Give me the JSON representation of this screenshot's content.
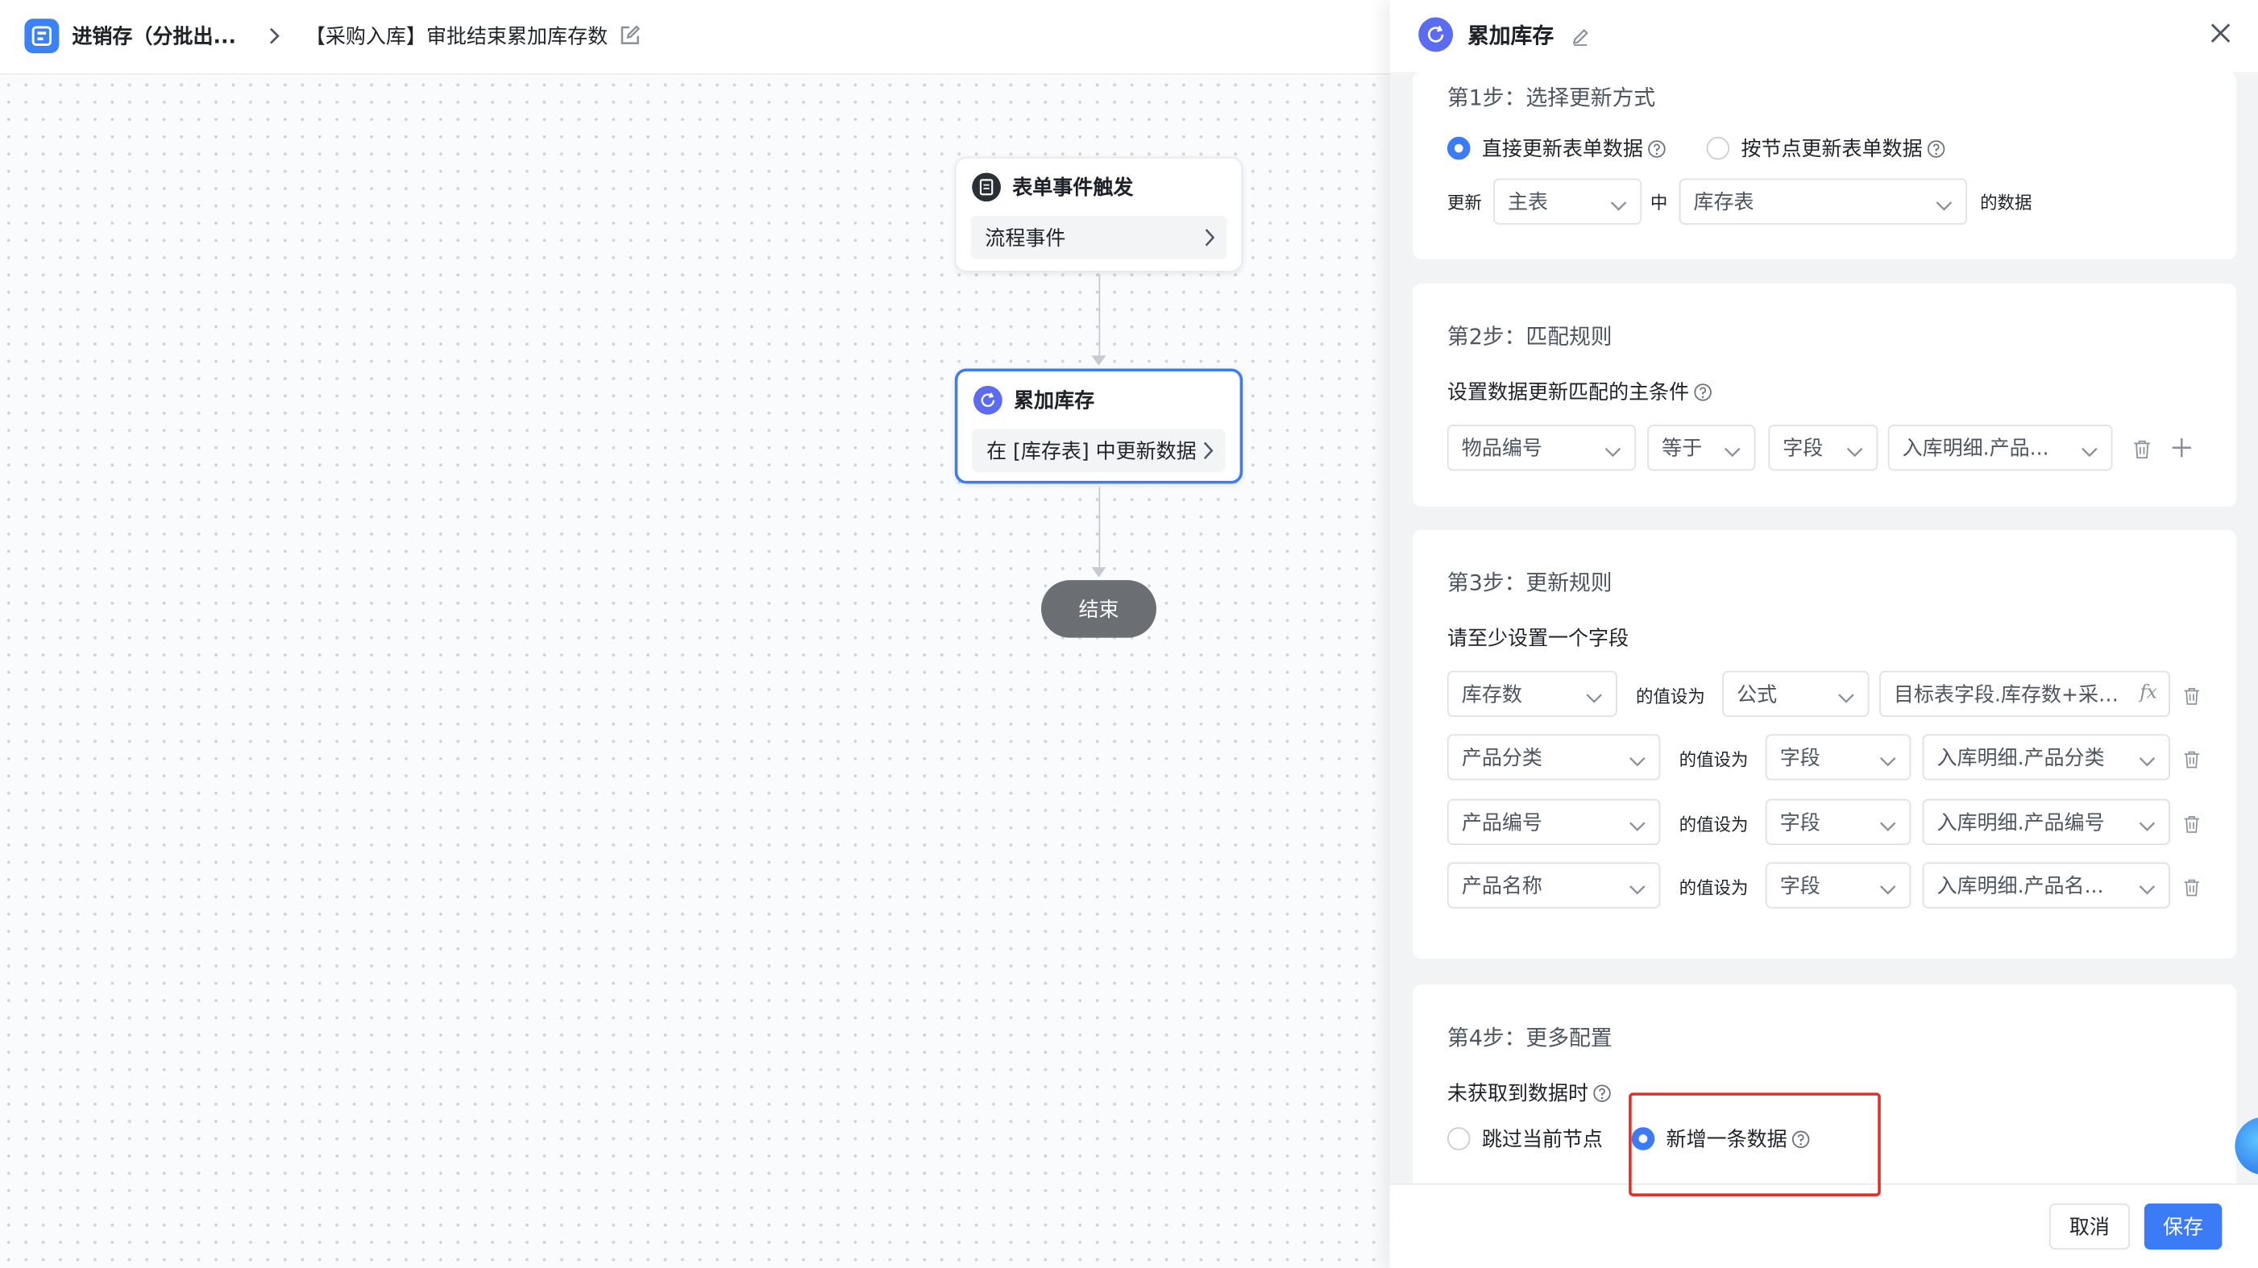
{
  "topbar": {
    "app_name": "进销存（分批出...",
    "flow_name": "【采购入库】审批结束累加库存数"
  },
  "canvas": {
    "trigger_node": {
      "title": "表单事件触发",
      "body": "流程事件"
    },
    "update_node": {
      "title": "累加库存",
      "body": "在 [库存表] 中更新数据"
    },
    "end_node": {
      "label": "结束"
    }
  },
  "panel": {
    "title": "累加库存",
    "step1": {
      "title": "第1步：选择更新方式",
      "option_direct": "直接更新表单数据",
      "option_by_node": "按节点更新表单数据",
      "selected": "direct",
      "update_label": "更新",
      "table_select": "主表",
      "in_label": "中",
      "target_select": "库存表",
      "data_suffix": "的数据"
    },
    "step2": {
      "title": "第2步：匹配规则",
      "desc": "设置数据更新匹配的主条件",
      "condition": {
        "field": "物品编号",
        "operator": "等于",
        "value_type": "字段",
        "value": "入库明细.产品..."
      }
    },
    "step3": {
      "title": "第3步：更新规则",
      "desc": "请至少设置一个字段",
      "set_as_label": "的值设为",
      "rules": [
        {
          "field": "库存数",
          "type": "公式",
          "value": "目标表字段.库存数+采购明"
        },
        {
          "field": "产品分类",
          "type": "字段",
          "value": "入库明细.产品分类"
        },
        {
          "field": "产品编号",
          "type": "字段",
          "value": "入库明细.产品编号"
        },
        {
          "field": "产品名称",
          "type": "字段",
          "value": "入库明细.产品名..."
        }
      ]
    },
    "step4": {
      "title": "第4步：更多配置",
      "desc": "未获取到数据时",
      "option_skip": "跳过当前节点",
      "option_add": "新增一条数据",
      "selected": "add"
    },
    "footer": {
      "cancel": "取消",
      "save": "保存"
    }
  }
}
